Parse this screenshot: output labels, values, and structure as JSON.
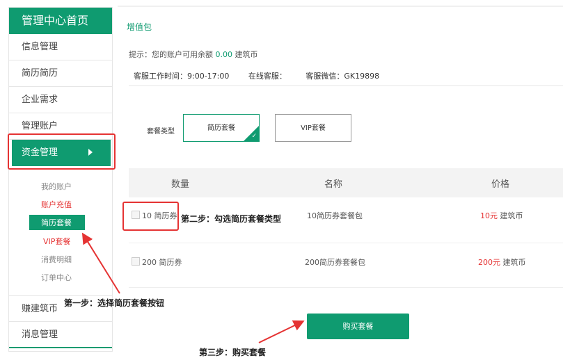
{
  "sidebar": {
    "header": "管理中心首页",
    "items": [
      "信息管理",
      "简历简历",
      "企业需求",
      "管理账户"
    ],
    "active": "资金管理",
    "sub_items": [
      "我的账户",
      "账户充值",
      "简历套餐",
      "VIP套餐",
      "消费明细",
      "订单中心"
    ],
    "bottom_items": [
      "赚建筑币",
      "消息管理"
    ]
  },
  "main": {
    "title": "增值包",
    "hint_prefix": "提示：您的账户可用余额",
    "balance": "0.00",
    "hint_suffix": "建筑币",
    "service_hours": "客服工作时间：9:00-17:00",
    "online_service": "在线客服：",
    "wechat": "客服微信：GK19898",
    "package_type_label": "套餐类型",
    "packages": [
      {
        "label": "简历套餐",
        "selected": true
      },
      {
        "label": "VIP套餐",
        "selected": false
      }
    ],
    "table": {
      "headers": [
        "数量",
        "名称",
        "价格"
      ],
      "rows": [
        {
          "qty": "10 简历券",
          "name": "10简历券套餐包",
          "price": "10元",
          "unit": "建筑币"
        },
        {
          "qty": "200 简历券",
          "name": "200简历券套餐包",
          "price": "200元",
          "unit": "建筑币"
        }
      ]
    },
    "buy_button": "购买套餐"
  },
  "annotations": {
    "step1": "第一步：选择简历套餐按钮",
    "step2": "第二步：勾选简历套餐类型",
    "step3": "第三步：购买套餐"
  },
  "colors": {
    "accent": "#0f9b70",
    "highlight": "#e53333"
  }
}
